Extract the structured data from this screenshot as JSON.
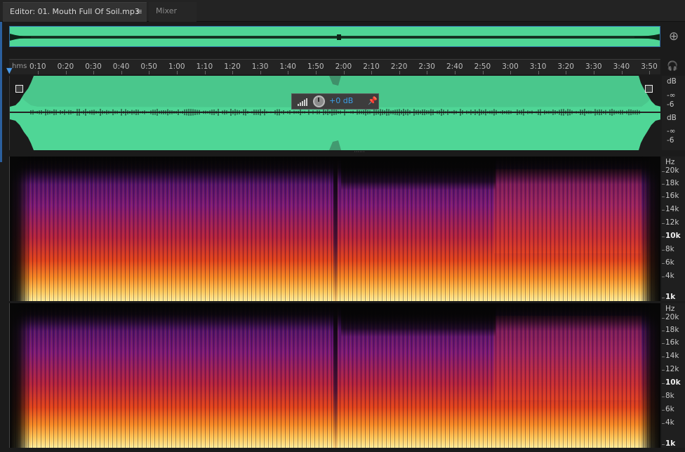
{
  "tabs": {
    "editor_label": "Editor: 01. Mouth Full Of Soil.mp3",
    "editor_menu_icon": "≡",
    "mixer_label": "Mixer"
  },
  "icons": {
    "zoom": "zoom-in-icon",
    "headphones": "headphones-icon",
    "playhead": "playhead-marker-icon",
    "pin": "pin-icon",
    "level_meter": "level-meter-icon",
    "volume_knob": "volume-knob-icon"
  },
  "ruler": {
    "unit": "hms",
    "labels": [
      "0:10",
      "0:20",
      "0:30",
      "0:40",
      "0:50",
      "1:00",
      "1:10",
      "1:20",
      "1:30",
      "1:40",
      "1:50",
      "2:00",
      "2:10",
      "2:20",
      "2:30",
      "2:40",
      "2:50",
      "3:00",
      "3:10",
      "3:20",
      "3:30",
      "3:40",
      "3:50"
    ]
  },
  "hud": {
    "gain_value": "+0 dB"
  },
  "waveform_scale": {
    "ch1": [
      "dB",
      "-∞",
      "-6"
    ],
    "ch2": [
      "dB",
      "-∞",
      "-6"
    ]
  },
  "spectral_scale": {
    "unit": "Hz",
    "labels": [
      "20k",
      "18k",
      "16k",
      "14k",
      "12k",
      "10k",
      "8k",
      "6k",
      "4k",
      "1k"
    ]
  },
  "colors": {
    "waveform": "#4fd696",
    "accent": "#3b9fe8",
    "background": "#1b1b1b"
  }
}
